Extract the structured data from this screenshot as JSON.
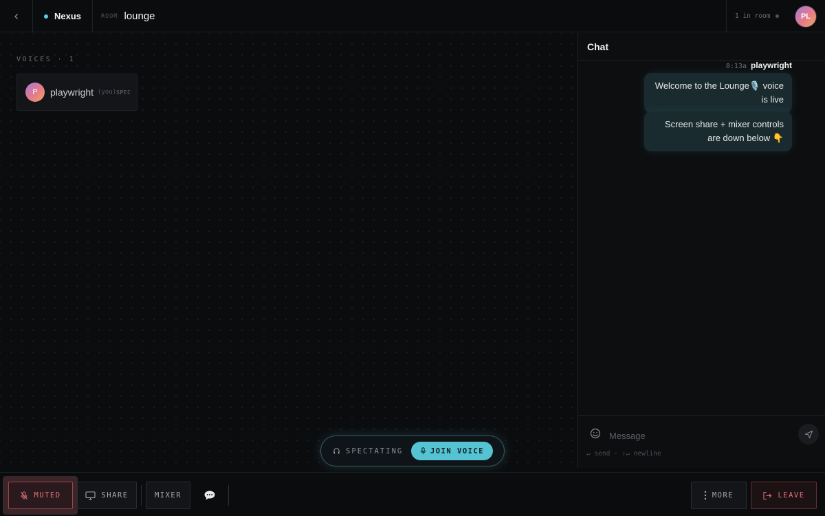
{
  "header": {
    "brand": "Nexus",
    "room_kicker": "ROOM",
    "room_name": "lounge",
    "in_room": "1 in room",
    "avatar_initials": "PL"
  },
  "stage": {
    "voices_header": "VOICES · 1",
    "voices": [
      {
        "initial": "P",
        "name": "playwright",
        "you_tag": "(you)",
        "status": "SPEC"
      }
    ]
  },
  "voice_pill": {
    "spectating_label": "SPECTATING",
    "join_label": "JOIN VOICE"
  },
  "chat": {
    "title": "Chat",
    "messages_meta": {
      "time": "8:13a",
      "author": "playwright"
    },
    "messages": [
      {
        "text": "Welcome to the Lounge🎙️ voice is live"
      },
      {
        "text": "Screen share + mixer controls are down below 👇"
      }
    ],
    "composer": {
      "placeholder": "Message",
      "hint": "↵ send · ⇧↵ newline"
    }
  },
  "toolbar": {
    "muted_label": "MUTED",
    "share_label": "SHARE",
    "mixer_label": "MIXER",
    "more_label": "MORE",
    "leave_label": "LEAVE"
  },
  "colors": {
    "accent": "#56c3d2",
    "danger": "#e0707a",
    "background": "#0a0b0d"
  }
}
